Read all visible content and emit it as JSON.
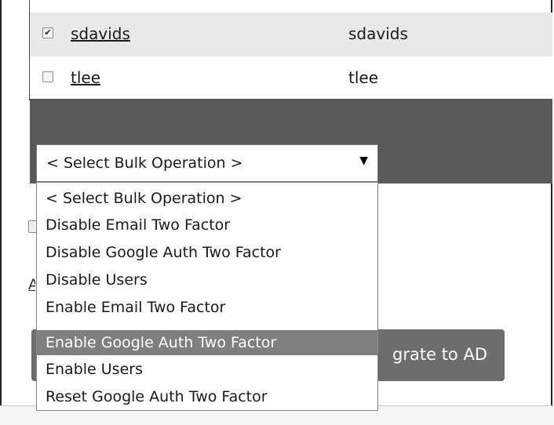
{
  "users": [
    {
      "username": "sdavids",
      "login": "sdavids",
      "checked": true
    },
    {
      "username": "tlee",
      "login": "tlee",
      "checked": false
    }
  ],
  "bulk": {
    "selected_label": "< Select Bulk Operation >",
    "caret": "▼",
    "options": [
      "< Select Bulk Operation >",
      "Disable Email Two Factor",
      "Disable Google Auth Two Factor",
      "Disable Users",
      "Enable Email Two Factor",
      "Enable Google Auth Two Factor",
      "Enable Users",
      "Reset Google Auth Two Factor"
    ],
    "highlighted_option": "Enable Google Auth Two Factor"
  },
  "actions": {
    "migrate_label": "grate to AD"
  },
  "partially_visible": {
    "link_fragment": "A"
  },
  "icons": {
    "checkbox_checked": "check-mark",
    "dropdown_caret": "caret-down-icon"
  },
  "colors": {
    "row_alt_bg": "#e9e9e9",
    "bulk_bar_bg": "#595959",
    "migrate_button_bg": "#6d6d6d",
    "option_highlight_bg": "#7f7f7f"
  }
}
